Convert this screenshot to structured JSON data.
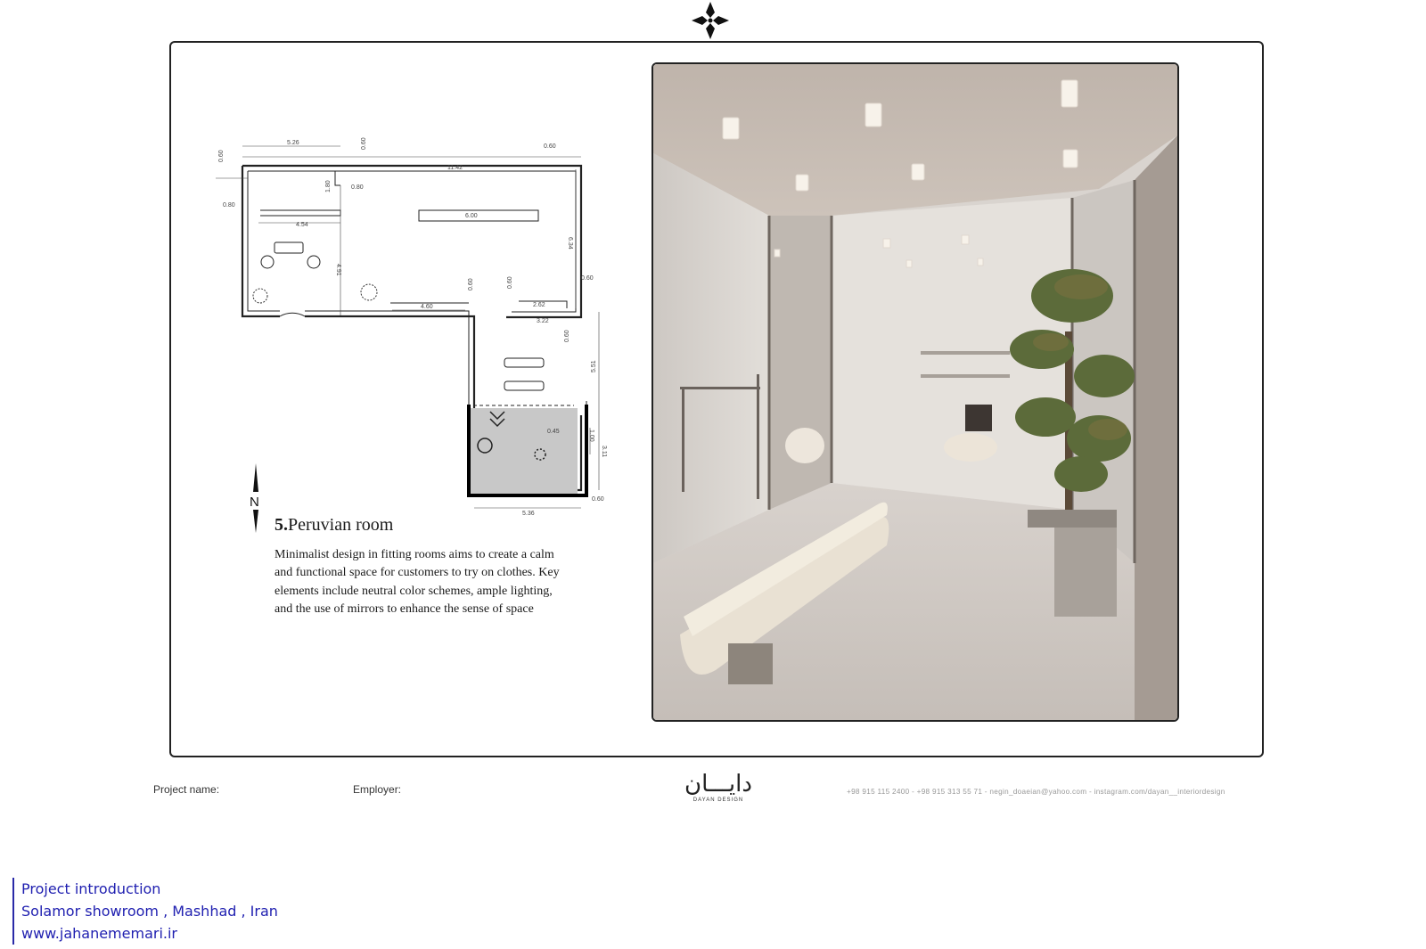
{
  "logo": {
    "icon": "four-petal-ornament-icon"
  },
  "floor_plan": {
    "dimensions": [
      "5.26",
      "0.60",
      "0.60",
      "0.60",
      "11.42",
      "1.80",
      "0.80",
      "0.80",
      "4.54",
      "6.00",
      "6.34",
      "4.91",
      "4.60",
      "0.60",
      "0.60",
      "0.60",
      "2.62",
      "3.22",
      "0.60",
      "5.51",
      "0.45",
      "1.00",
      "3.11",
      "5.36",
      "0.60"
    ],
    "compass_letter": "N"
  },
  "room": {
    "number": "5.",
    "title": "Peruvian room",
    "description": "Minimalist design in fitting rooms aims to create a calm and functional space for customers to try on clothes. Key elements include neutral color schemes, ample lighting, and the use of mirrors to enhance the sense of space"
  },
  "footer": {
    "project_name_label": "Project name:",
    "employer_label": "Employer:",
    "brand_arabic": "دایـــان",
    "brand_sub": "DAYAN DESIGN",
    "contact": "+98 915 115 2400 - +98 915 313 55 71 - negin_doaeian@yahoo.com - instagram.com/dayan__interiordesign"
  },
  "intro": {
    "line1": "Project introduction",
    "line2": "Solamor showroom , Mashhad , Iran",
    "line3": "www.jahanememari.ir"
  },
  "colors": {
    "frame": "#222222",
    "intro_text": "#1f1fb0",
    "render_wall": "#d7d2cc",
    "render_floor": "#cfc8c2"
  }
}
